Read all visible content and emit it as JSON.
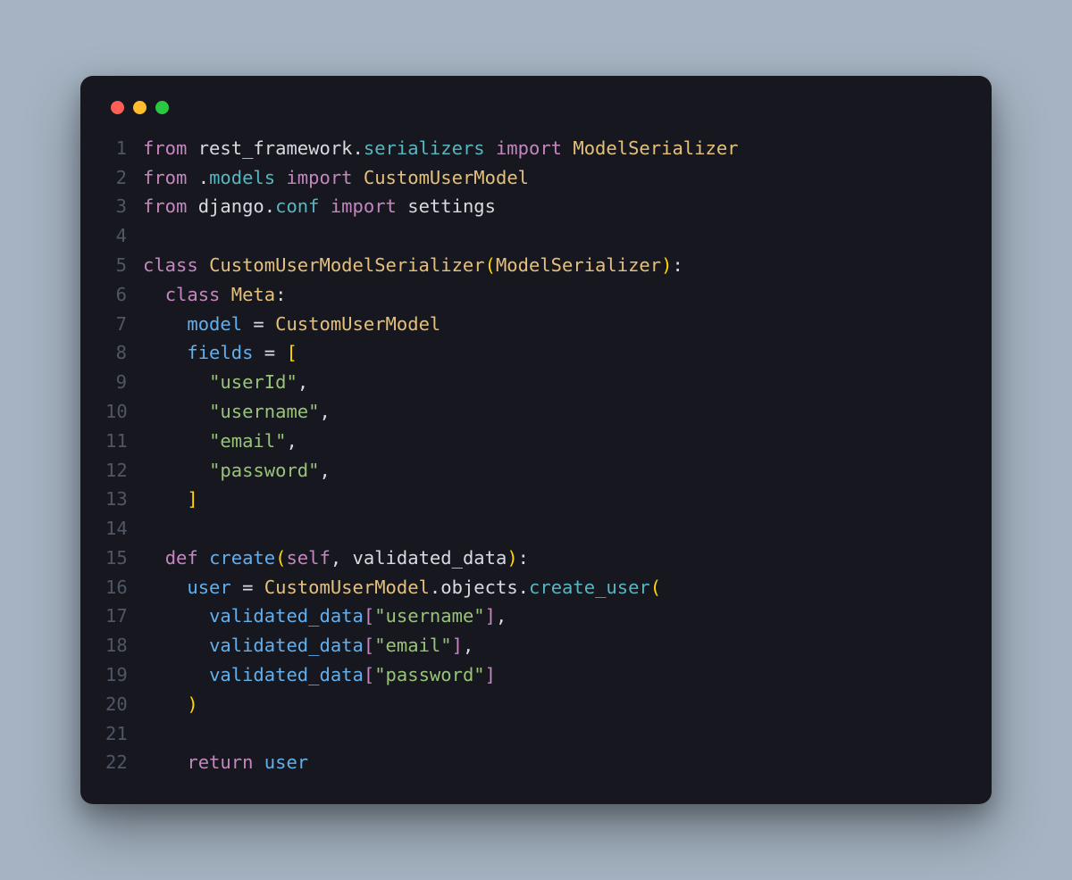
{
  "window": {
    "traffic_lights": [
      "red",
      "yellow",
      "green"
    ]
  },
  "code": {
    "lines": [
      {
        "n": 1,
        "tokens": [
          {
            "t": "from ",
            "c": "keyword"
          },
          {
            "t": "rest_framework",
            "c": "module"
          },
          {
            "t": ".",
            "c": "dot"
          },
          {
            "t": "serializers",
            "c": "func"
          },
          {
            "t": " import ",
            "c": "keyword"
          },
          {
            "t": "ModelSerializer",
            "c": "class"
          }
        ]
      },
      {
        "n": 2,
        "tokens": [
          {
            "t": "from ",
            "c": "keyword"
          },
          {
            "t": ".",
            "c": "dot"
          },
          {
            "t": "models",
            "c": "func"
          },
          {
            "t": " import ",
            "c": "keyword"
          },
          {
            "t": "CustomUserModel",
            "c": "class"
          }
        ]
      },
      {
        "n": 3,
        "tokens": [
          {
            "t": "from ",
            "c": "keyword"
          },
          {
            "t": "django",
            "c": "module"
          },
          {
            "t": ".",
            "c": "dot"
          },
          {
            "t": "conf",
            "c": "func"
          },
          {
            "t": " import ",
            "c": "keyword"
          },
          {
            "t": "settings",
            "c": "module"
          }
        ]
      },
      {
        "n": 4,
        "tokens": [
          {
            "t": "",
            "c": "plain"
          }
        ]
      },
      {
        "n": 5,
        "tokens": [
          {
            "t": "class ",
            "c": "keyword"
          },
          {
            "t": "CustomUserModelSerializer",
            "c": "class"
          },
          {
            "t": "(",
            "c": "bracket"
          },
          {
            "t": "ModelSerializer",
            "c": "class"
          },
          {
            "t": ")",
            "c": "bracket"
          },
          {
            "t": ":",
            "c": "punct"
          }
        ]
      },
      {
        "n": 6,
        "tokens": [
          {
            "t": "  ",
            "c": "plain"
          },
          {
            "t": "class ",
            "c": "keyword"
          },
          {
            "t": "Meta",
            "c": "class"
          },
          {
            "t": ":",
            "c": "punct"
          }
        ]
      },
      {
        "n": 7,
        "tokens": [
          {
            "t": "    ",
            "c": "plain"
          },
          {
            "t": "model",
            "c": "ident"
          },
          {
            "t": " = ",
            "c": "op"
          },
          {
            "t": "CustomUserModel",
            "c": "class"
          }
        ]
      },
      {
        "n": 8,
        "tokens": [
          {
            "t": "    ",
            "c": "plain"
          },
          {
            "t": "fields",
            "c": "ident"
          },
          {
            "t": " = ",
            "c": "op"
          },
          {
            "t": "[",
            "c": "bracket"
          }
        ]
      },
      {
        "n": 9,
        "tokens": [
          {
            "t": "      ",
            "c": "plain"
          },
          {
            "t": "\"userId\"",
            "c": "string"
          },
          {
            "t": ",",
            "c": "punct"
          }
        ]
      },
      {
        "n": 10,
        "tokens": [
          {
            "t": "      ",
            "c": "plain"
          },
          {
            "t": "\"username\"",
            "c": "string"
          },
          {
            "t": ",",
            "c": "punct"
          }
        ]
      },
      {
        "n": 11,
        "tokens": [
          {
            "t": "      ",
            "c": "plain"
          },
          {
            "t": "\"email\"",
            "c": "string"
          },
          {
            "t": ",",
            "c": "punct"
          }
        ]
      },
      {
        "n": 12,
        "tokens": [
          {
            "t": "      ",
            "c": "plain"
          },
          {
            "t": "\"password\"",
            "c": "string"
          },
          {
            "t": ",",
            "c": "punct"
          }
        ]
      },
      {
        "n": 13,
        "tokens": [
          {
            "t": "    ",
            "c": "plain"
          },
          {
            "t": "]",
            "c": "bracket"
          }
        ]
      },
      {
        "n": 14,
        "tokens": [
          {
            "t": "",
            "c": "plain"
          }
        ]
      },
      {
        "n": 15,
        "tokens": [
          {
            "t": "  ",
            "c": "plain"
          },
          {
            "t": "def ",
            "c": "keyword"
          },
          {
            "t": "create",
            "c": "funcdef"
          },
          {
            "t": "(",
            "c": "bracket"
          },
          {
            "t": "self",
            "c": "self"
          },
          {
            "t": ", ",
            "c": "punct"
          },
          {
            "t": "validated_data",
            "c": "param"
          },
          {
            "t": ")",
            "c": "bracket"
          },
          {
            "t": ":",
            "c": "punct"
          }
        ]
      },
      {
        "n": 16,
        "tokens": [
          {
            "t": "    ",
            "c": "plain"
          },
          {
            "t": "user",
            "c": "ident"
          },
          {
            "t": " = ",
            "c": "op"
          },
          {
            "t": "CustomUserModel",
            "c": "class"
          },
          {
            "t": ".",
            "c": "dot"
          },
          {
            "t": "objects",
            "c": "attr"
          },
          {
            "t": ".",
            "c": "dot"
          },
          {
            "t": "create_user",
            "c": "func"
          },
          {
            "t": "(",
            "c": "bracket"
          }
        ]
      },
      {
        "n": 17,
        "tokens": [
          {
            "t": "      ",
            "c": "plain"
          },
          {
            "t": "validated_data",
            "c": "ident"
          },
          {
            "t": "[",
            "c": "bracket2"
          },
          {
            "t": "\"username\"",
            "c": "string"
          },
          {
            "t": "]",
            "c": "bracket2"
          },
          {
            "t": ",",
            "c": "punct"
          }
        ]
      },
      {
        "n": 18,
        "tokens": [
          {
            "t": "      ",
            "c": "plain"
          },
          {
            "t": "validated_data",
            "c": "ident"
          },
          {
            "t": "[",
            "c": "bracket2"
          },
          {
            "t": "\"email\"",
            "c": "string"
          },
          {
            "t": "]",
            "c": "bracket2"
          },
          {
            "t": ",",
            "c": "punct"
          }
        ]
      },
      {
        "n": 19,
        "tokens": [
          {
            "t": "      ",
            "c": "plain"
          },
          {
            "t": "validated_data",
            "c": "ident"
          },
          {
            "t": "[",
            "c": "bracket2"
          },
          {
            "t": "\"password\"",
            "c": "string"
          },
          {
            "t": "]",
            "c": "bracket2"
          }
        ]
      },
      {
        "n": 20,
        "tokens": [
          {
            "t": "    ",
            "c": "plain"
          },
          {
            "t": ")",
            "c": "bracket"
          }
        ]
      },
      {
        "n": 21,
        "tokens": [
          {
            "t": "",
            "c": "plain"
          }
        ]
      },
      {
        "n": 22,
        "tokens": [
          {
            "t": "    ",
            "c": "plain"
          },
          {
            "t": "return ",
            "c": "keyword"
          },
          {
            "t": "user",
            "c": "ident"
          }
        ]
      }
    ]
  }
}
